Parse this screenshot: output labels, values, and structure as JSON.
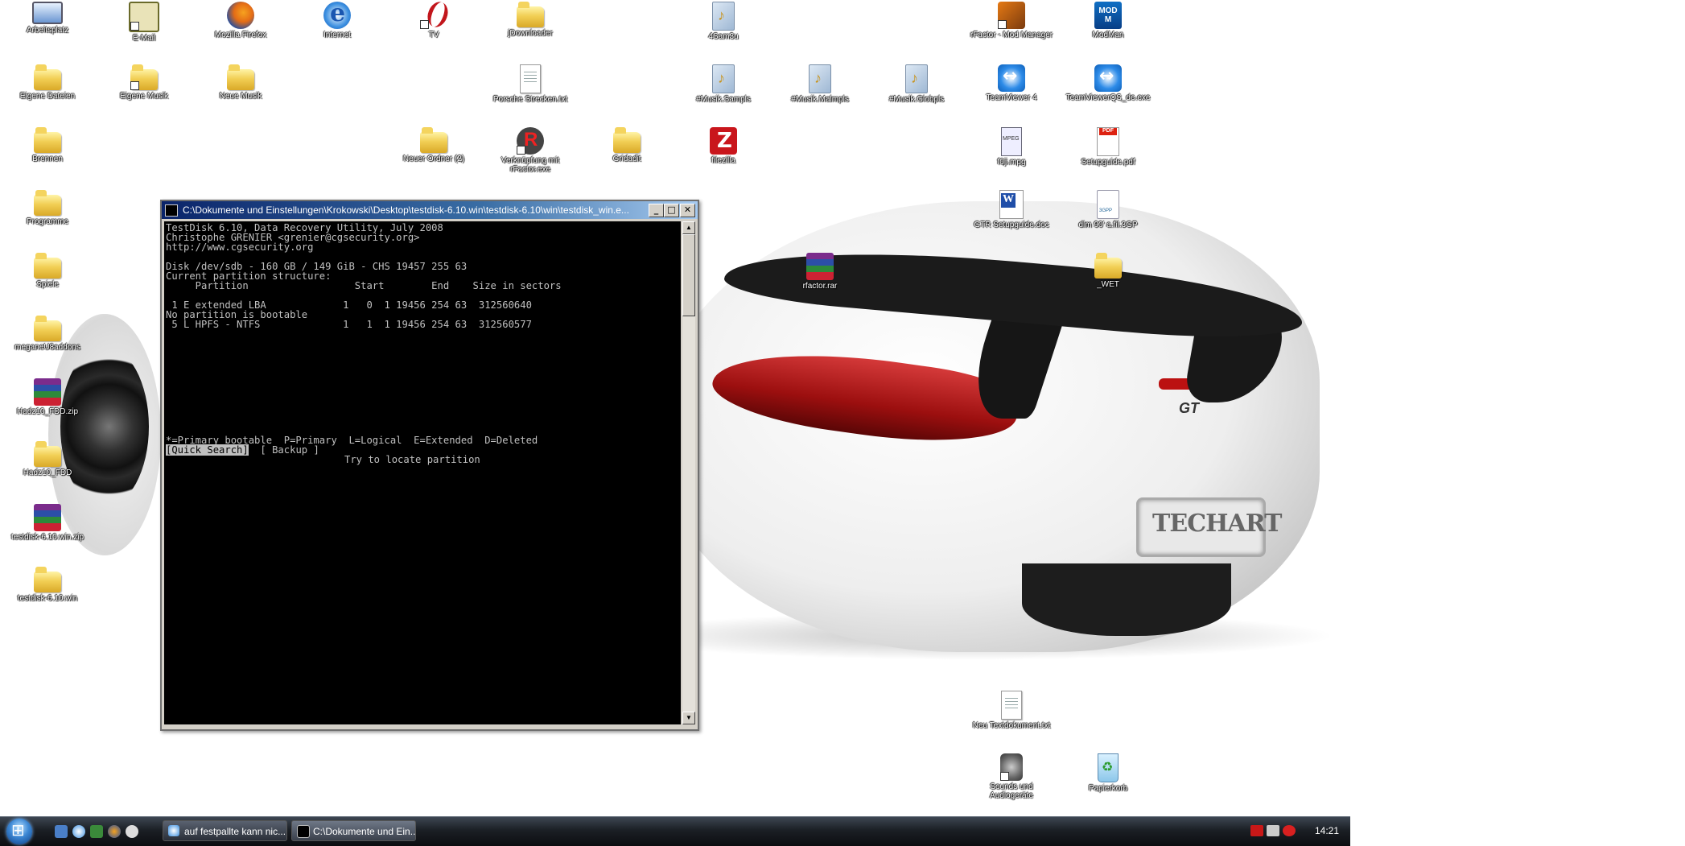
{
  "desktop_icons": [
    {
      "label": "Arbeitsplatz"
    },
    {
      "label": "E-Mail"
    },
    {
      "label": "Mozilla Firefox"
    },
    {
      "label": "Internet"
    },
    {
      "label": "TV"
    },
    {
      "label": "jDownloader"
    },
    {
      "label": "4Sam3u"
    },
    {
      "label": "rFactor - Mod Manager"
    },
    {
      "label": "ModMan"
    },
    {
      "label": "Eigene Dateien"
    },
    {
      "label": "Eigene Musik"
    },
    {
      "label": "Neue Musik"
    },
    {
      "label": "Porsche Strecken.txt"
    },
    {
      "label": "#Musik.Sampls"
    },
    {
      "label": "#Musik.Malmpls"
    },
    {
      "label": "#Musik.Globpls"
    },
    {
      "label": "TeamViewer 4"
    },
    {
      "label": "TeamViewerQS_de.exe"
    },
    {
      "label": "Brennen"
    },
    {
      "label": "Neuer Ordner (2)"
    },
    {
      "label": "Verknüpfung mit rFactor.exe"
    },
    {
      "label": "Gridadit"
    },
    {
      "label": "filezilla"
    },
    {
      "label": "f0ji.mpg"
    },
    {
      "label": "Setupguide.pdf"
    },
    {
      "label": "Programme"
    },
    {
      "label": "GTR Setupguide.doc"
    },
    {
      "label": "dlm 90' a.fil.3GP"
    },
    {
      "label": "rfactor.rar"
    },
    {
      "label": "_WET"
    },
    {
      "label": "Spiele"
    },
    {
      "label": "meganeU8addons"
    },
    {
      "label": "Hadz10_FDD.zip"
    },
    {
      "label": "Hadz10_FDD"
    },
    {
      "label": "testdisk-6.10.win.zip"
    },
    {
      "label": "testdisk-6.10.win"
    },
    {
      "label": "Neu Textdokument.txt"
    },
    {
      "label": "Sounds und Audiogeräte"
    },
    {
      "label": "Papierkorb"
    }
  ],
  "wallpaper": {
    "badge": "GT",
    "plate": "TECHART"
  },
  "console": {
    "title": "C:\\Dokumente und Einstellungen\\Krokowski\\Desktop\\testdisk-6.10.win\\testdisk-6.10\\win\\testdisk_win.e...",
    "buttons": {
      "minimize": "_",
      "maximize": "□",
      "close": "✕"
    },
    "lines": [
      "TestDisk 6.10, Data Recovery Utility, July 2008",
      "Christophe GRENIER <grenier@cgsecurity.org>",
      "http://www.cgsecurity.org",
      "",
      "Disk /dev/sdb - 160 GB / 149 GiB - CHS 19457 255 63",
      "Current partition structure:",
      "     Partition                  Start        End    Size in sectors",
      "",
      " 1 E extended LBA             1   0  1 19456 254 63  312560640",
      "No partition is bootable",
      " 5 L HPFS - NTFS              1   1  1 19456 254 63  312560577"
    ],
    "legend": "*=Primary bootable  P=Primary  L=Logical  E=Extended  D=Deleted",
    "menu_selected": "[Quick Search]",
    "menu_other": "[ Backup ]",
    "hint": "Try to locate partition"
  },
  "taskbar": {
    "tasks": [
      {
        "label": "auf festpallte kann nic..."
      },
      {
        "label": "C:\\Dokumente und Ein..."
      }
    ],
    "clock": "14:21",
    "colors": {
      "accent": "#3c87d4"
    }
  }
}
